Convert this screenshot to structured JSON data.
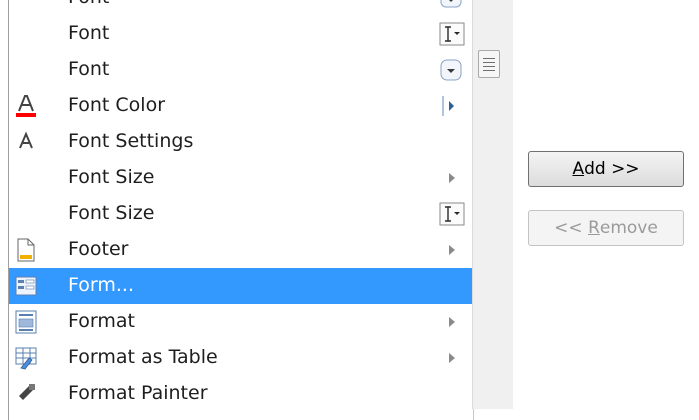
{
  "commands": [
    {
      "label": "Font",
      "control": "dropdown-arrow"
    },
    {
      "label": "Font",
      "control": "text-cursor-dropdown"
    },
    {
      "label": "Font",
      "control": "dropdown-arrow"
    },
    {
      "label": "Font Color",
      "icon": "font-color-icon",
      "control": "split-arrow"
    },
    {
      "label": "Font Settings",
      "icon": "font-settings-icon"
    },
    {
      "label": "Font Size",
      "control": "submenu-arrow"
    },
    {
      "label": "Font Size",
      "control": "text-cursor-dropdown"
    },
    {
      "label": "Footer",
      "icon": "page-icon",
      "control": "submenu-arrow"
    },
    {
      "label": "Form...",
      "icon": "form-icon",
      "selected": true
    },
    {
      "label": "Format",
      "icon": "format-icon",
      "control": "submenu-arrow"
    },
    {
      "label": "Format as Table",
      "icon": "format-table-icon",
      "control": "submenu-arrow"
    },
    {
      "label": "Format Painter",
      "icon": "format-painter-icon"
    }
  ],
  "buttons": {
    "add": {
      "mnemonic": "A",
      "rest": "dd >>"
    },
    "remove": {
      "prefix": "<< ",
      "mnemonic": "R",
      "rest": "emove"
    }
  },
  "colors": {
    "selection": "#3399ff",
    "font_color_bar": "#ff0000"
  }
}
